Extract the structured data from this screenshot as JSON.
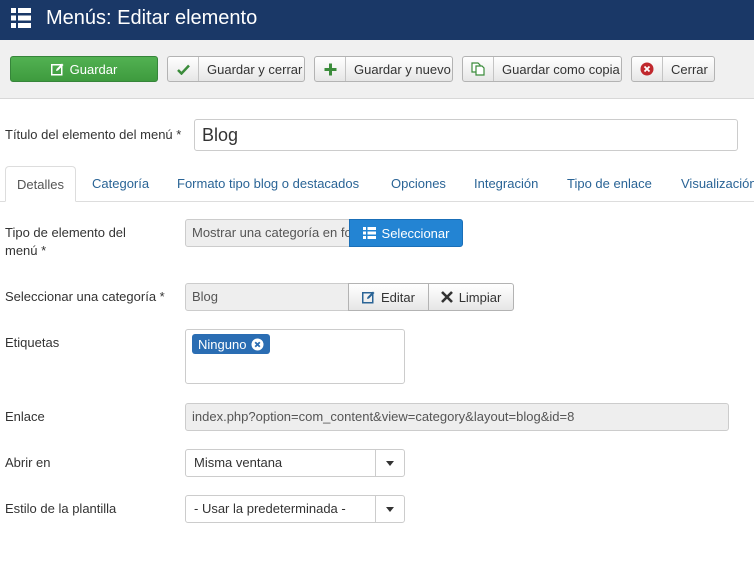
{
  "header": {
    "title": "Menús: Editar elemento",
    "icon": "list-menu-icon"
  },
  "toolbar": {
    "save_label": "Guardar",
    "save_close_label": "Guardar y cerrar",
    "save_new_label": "Guardar y nuevo",
    "save_copy_label": "Guardar como copia",
    "close_label": "Cerrar"
  },
  "form": {
    "title_label": "Título del elemento del menú *",
    "title_value": "Blog"
  },
  "tabs": [
    {
      "label": "Detalles",
      "active": true
    },
    {
      "label": "Categoría"
    },
    {
      "label": "Formato tipo blog o destacados"
    },
    {
      "label": "Opciones"
    },
    {
      "label": "Integración"
    },
    {
      "label": "Tipo de enlace"
    },
    {
      "label": "Visualización"
    }
  ],
  "fields": {
    "item_type": {
      "label_line1": "Tipo de elemento del",
      "label_line2": "menú *",
      "value": "Mostrar una categoría en formato blog",
      "select_label": "Seleccionar"
    },
    "category": {
      "label": "Seleccionar una categoría *",
      "value": "Blog",
      "edit_label": "Editar",
      "clear_label": "Limpiar"
    },
    "tags": {
      "label": "Etiquetas",
      "chip": "Ninguno"
    },
    "link": {
      "label": "Enlace",
      "value": "index.php?option=com_content&view=category&layout=blog&id=8"
    },
    "open_in": {
      "label": "Abrir en",
      "value": "Misma ventana"
    },
    "template_style": {
      "label": "Estilo de la plantilla",
      "value": "- Usar la predeterminada -"
    }
  },
  "colors": {
    "header_bg": "#1a3867",
    "save_green": "#46a546",
    "select_blue": "#2384d3",
    "link_blue": "#2a6496",
    "chip_blue": "#2a6db3"
  }
}
